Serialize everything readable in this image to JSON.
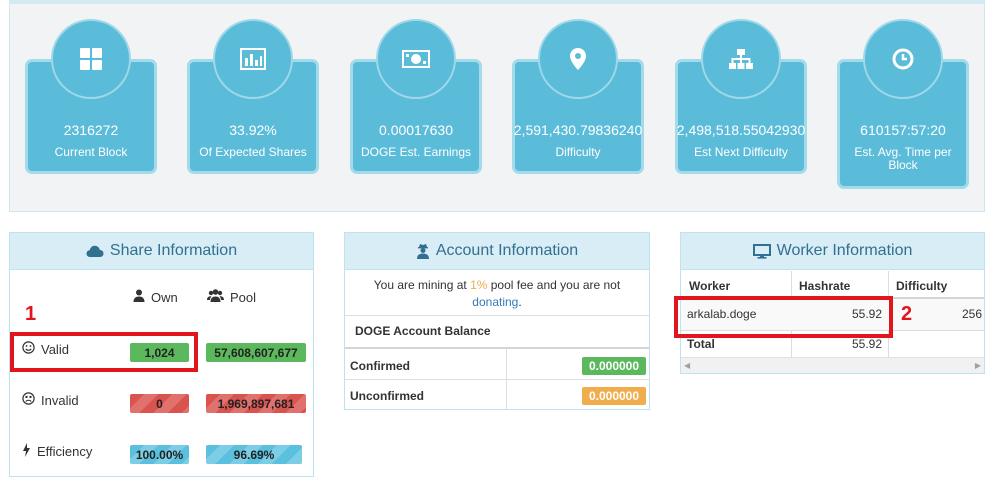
{
  "stats": [
    {
      "value": "2316272",
      "label": "Current Block",
      "icon": "blocks-icon"
    },
    {
      "value": "33.92%",
      "label": "Of Expected Shares",
      "icon": "bar-chart-icon"
    },
    {
      "value": "0.00017630",
      "label": "DOGE Est. Earnings",
      "icon": "money-icon"
    },
    {
      "value": "2,591,430.79836240",
      "label": "Difficulty",
      "icon": "map-marker-icon"
    },
    {
      "value": "2,498,518.55042930",
      "label": "Est Next Difficulty",
      "icon": "sitemap-icon"
    },
    {
      "value": "610157:57:20",
      "label": "Est. Avg. Time per Block",
      "icon": "clock-icon"
    }
  ],
  "share_info": {
    "title": "Share Information",
    "own_label": "Own",
    "pool_label": "Pool",
    "rows": [
      {
        "label": "Valid",
        "own": "1,024",
        "pool": "57,608,607,677"
      },
      {
        "label": "Invalid",
        "own": "0",
        "pool": "1,969,897,681"
      },
      {
        "label": "Efficiency",
        "own": "100.00%",
        "pool": "96.69%"
      }
    ]
  },
  "account_info": {
    "title": "Account Information",
    "notice_pre": "You are mining at ",
    "fee": "1%",
    "notice_post": " pool fee and you are not",
    "donating": "donating",
    "notice_end": ".",
    "balance_title": "DOGE Account Balance",
    "rows": [
      {
        "label": "Confirmed",
        "value": "0.000000"
      },
      {
        "label": "Unconfirmed",
        "value": "0.000000"
      }
    ]
  },
  "worker_info": {
    "title": "Worker Information",
    "headers": [
      "Worker",
      "Hashrate",
      "Difficulty"
    ],
    "rows": [
      {
        "worker": "arkalab.doge",
        "hashrate": "55.92",
        "difficulty": "256"
      }
    ],
    "total": {
      "label": "Total",
      "hashrate": "55.92"
    }
  },
  "annotations": {
    "one": "1",
    "two": "2"
  },
  "colors": {
    "card": "#5bbcd9",
    "heading_bg": "#d9edf7",
    "heading_text": "#31708f",
    "annotation": "#e0151e",
    "success": "#5cb85c",
    "danger": "#d9534f",
    "info": "#5bc0de",
    "warning": "#f0ad4e"
  }
}
